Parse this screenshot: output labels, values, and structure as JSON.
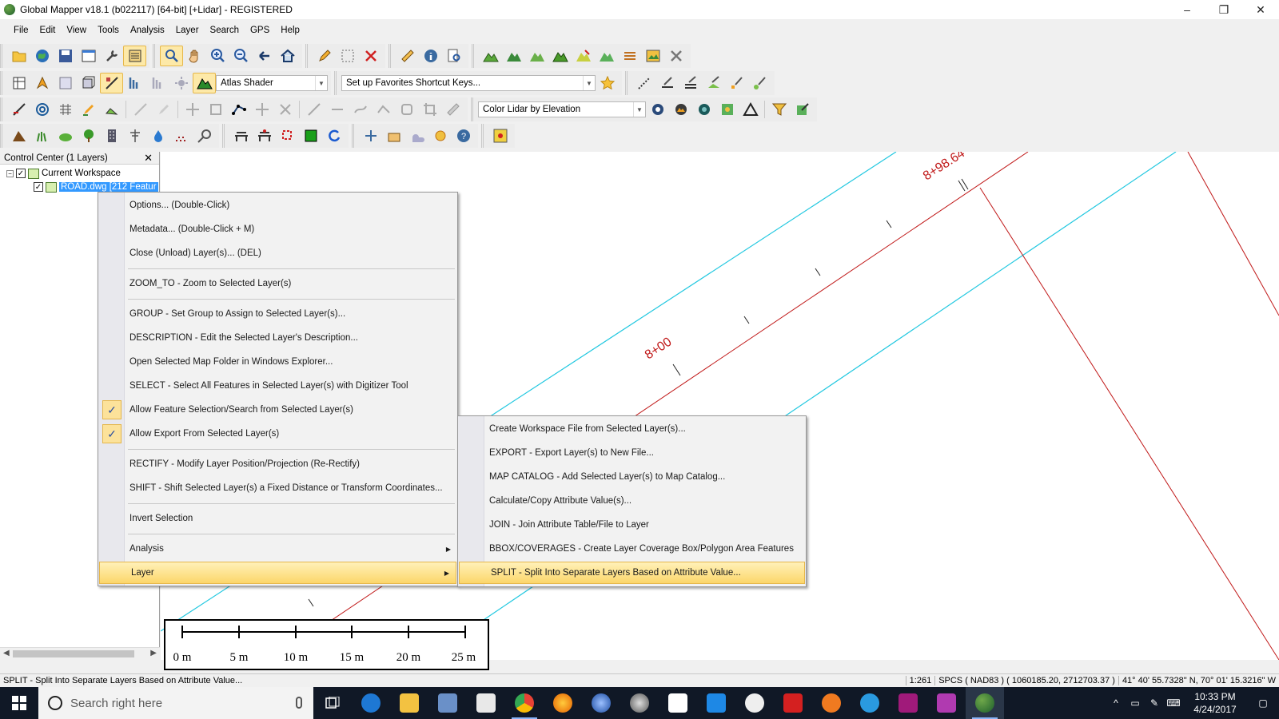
{
  "window": {
    "title": "Global Mapper v18.1 (b022117) [64-bit] [+Lidar] - REGISTERED",
    "minimize": "–",
    "restore": "❐",
    "close": "✕"
  },
  "menubar": [
    "File",
    "Edit",
    "View",
    "Tools",
    "Analysis",
    "Layer",
    "Search",
    "GPS",
    "Help"
  ],
  "toolbars": {
    "shader_combo": "Atlas Shader",
    "favorites_combo": "Set up Favorites Shortcut Keys...",
    "lidar_combo": "Color Lidar by Elevation"
  },
  "control_center": {
    "title": "Control Center (1 Layers)",
    "close": "✕",
    "workspace": "Current Workspace",
    "layer": "ROAD.dwg [212 Featur"
  },
  "map": {
    "station_label_1": "8+00",
    "station_label_2": "8+98.64",
    "colors": {
      "road_line": "#c01818",
      "edge_line": "#22c8e0",
      "background": "#ffffff"
    }
  },
  "scalebar": {
    "ticks": [
      "0 m",
      "5 m",
      "10 m",
      "15 m",
      "20 m",
      "25 m"
    ]
  },
  "context_menu": {
    "items": [
      "Options... (Double-Click)",
      "Metadata... (Double-Click + M)",
      "Close (Unload) Layer(s)... (DEL)",
      "ZOOM_TO - Zoom to Selected Layer(s)",
      "GROUP - Set Group to Assign to Selected Layer(s)...",
      "DESCRIPTION - Edit the Selected Layer's Description...",
      "Open Selected Map Folder in Windows Explorer...",
      "SELECT - Select All Features in Selected Layer(s) with Digitizer Tool",
      "Allow Feature Selection/Search from Selected Layer(s)",
      "Allow Export From Selected Layer(s)",
      "RECTIFY - Modify Layer Position/Projection (Re-Rectify)",
      "SHIFT - Shift Selected Layer(s) a Fixed Distance or Transform Coordinates...",
      "Invert Selection",
      "Analysis",
      "Layer"
    ],
    "check": "✓",
    "arrow": "▶"
  },
  "submenu": {
    "items": [
      "Create Workspace File from Selected Layer(s)...",
      "EXPORT - Export Layer(s) to New File...",
      "MAP CATALOG - Add Selected Layer(s) to Map Catalog...",
      "Calculate/Copy Attribute Value(s)...",
      "JOIN - Join Attribute Table/File to Layer",
      "BBOX/COVERAGES  - Create Layer Coverage Box/Polygon Area Features",
      "SPLIT - Split Into Separate Layers Based on Attribute Value..."
    ]
  },
  "statusbar": {
    "message": "SPLIT - Split Into Separate Layers Based on Attribute Value...",
    "scale": "1:261",
    "coords": "SPCS ( NAD83 ) ( 1060185.20, 2712703.37 )",
    "latlon": "41° 40' 55.7328\" N, 70° 01' 15.3216\" W"
  },
  "taskbar": {
    "search_placeholder": "Search right here",
    "time": "10:33 PM",
    "date": "4/24/2017"
  }
}
